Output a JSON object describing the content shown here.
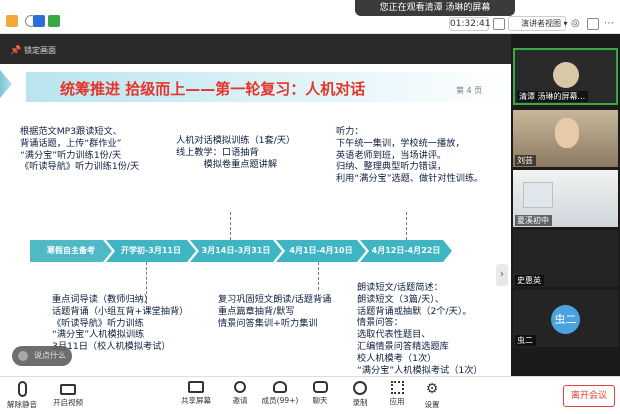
{
  "topbar": {
    "banner": "您正在观看清潭 汤琳的屏幕",
    "time": "01:32:41",
    "view_label": "演讲者视图"
  },
  "share": {
    "lock_label": "锁定画面",
    "comment_label": "说点什么"
  },
  "slide": {
    "title": "统筹推进  拾级而上——第一轮复习：人机对话",
    "page": "第 4 页",
    "top_blocks": [
      [
        "根据范文MP3跟读短文、",
        "背诵话题，上传“群作业”",
        "“满分宝”听力训练1份/天",
        "《听读导航》听力训练1份/天"
      ],
      [
        "人机对话模拟训练（1套/天）",
        "线上教学：口语抽背",
        "　　　模拟卷重点题讲解"
      ],
      [
        "听力：",
        "下午统一集训，学校统一播放，",
        "英语老师到班，当场讲评。",
        "  归纳、整理典型听力错误，",
        "利用“满分宝”选题、做针对性训练。"
      ]
    ],
    "timeline": [
      "寒假自主备考",
      "开学初-3月11日",
      "3月14日-3月31日",
      "4月1日-4月10日",
      "4月12日-4月22日"
    ],
    "bottom_blocks": [
      [
        "重点词导读（教师归纳）",
        "话题背诵（小组互背+课堂抽背）",
        "《听读导航》听力训练",
        "“满分宝”人机模拟训练",
        "3月11日（校人机模拟考试）"
      ],
      [
        "复习巩固短文朗读/话题背诵",
        "重点篇章抽背/默写",
        "情景问答集训+听力集训"
      ],
      [
        "朗读短文/话题简述：",
        "朗读短文（3篇/天）、",
        "话题背诵或抽默（2个/天）。",
        "情景问答：",
        "选取代表性题目、",
        "汇编情景问答精选题库",
        "校人机模考（1次）",
        "“满分宝”人机模拟考试（1次）"
      ]
    ]
  },
  "participants": [
    {
      "name": "清潭 汤琳的屏幕..."
    },
    {
      "name": "刘芸"
    },
    {
      "name": "夏溪初中"
    },
    {
      "name": "史惠英"
    },
    {
      "name": "虫二",
      "initials": "虫二"
    }
  ],
  "toolbar": {
    "mute": "解除静音",
    "video": "开启视频",
    "share": "共享屏幕",
    "invite": "邀请",
    "members": "成员(99+)",
    "chat": "聊天",
    "record": "录制",
    "apps": "应用",
    "settings": "设置",
    "leave": "离开会议"
  },
  "colors": {
    "title_red": "#e6352b",
    "timeline_teal": "#3fb5c4",
    "active_green": "#3aa745",
    "leave_red": "#e2433d"
  }
}
